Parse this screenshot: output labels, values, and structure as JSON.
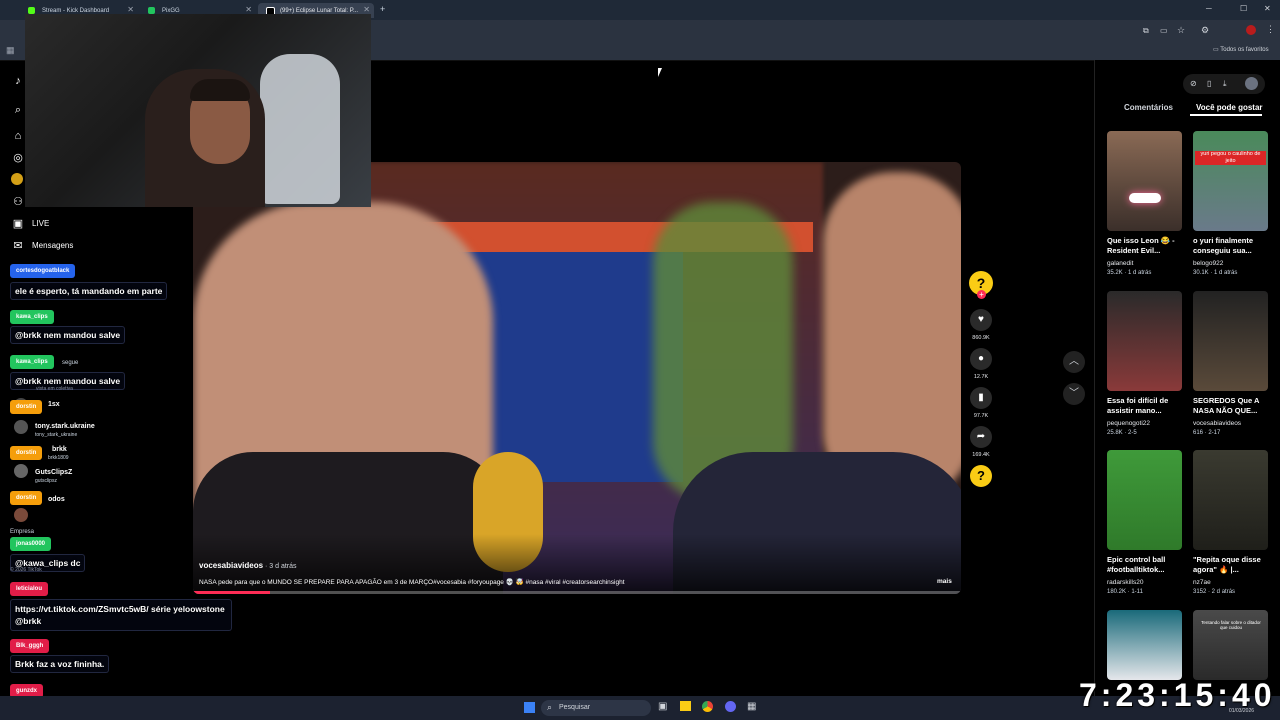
{
  "browser": {
    "tabs": [
      {
        "label": "Stream - Kick Dashboard"
      },
      {
        "label": "PixGG"
      },
      {
        "label": "(99+) Eclipse Lunar Total: P..."
      }
    ],
    "bookmarks_label": "Todos os favoritos"
  },
  "sidebar": {
    "live_label": "LIVE",
    "messages_label": "Mensagens",
    "faded_items": [
      "Seguir",
      "segue",
      "vista em coletiva",
      "1sx",
      "tony.stark.ukraine",
      "tony_stark_ukraine",
      "brkk",
      "brkk1809",
      "GutsClipsZ",
      "gutsclipsz",
      "odos",
      "Empresa",
      "© 2026 TikTok"
    ]
  },
  "chat": [
    {
      "user": "cortesdogoatblack",
      "color": "#2563eb",
      "message": "ele é esperto, tá mandando em parte"
    },
    {
      "user": "kawa_clips",
      "color": "#22c55e",
      "message": "@brkk nem mandou salve"
    },
    {
      "user": "kawa_clips",
      "color": "#22c55e",
      "message": "@brkk nem mandou salve"
    },
    {
      "user": "dorstin",
      "color": "#f59e0b",
      "message": ""
    },
    {
      "user": "dorstin",
      "color": "#f59e0b",
      "message": ""
    },
    {
      "user": "dorstin",
      "color": "#f59e0b",
      "message": ""
    },
    {
      "user": "jonas0000",
      "color": "#22c55e",
      "message": "@kawa_clips dc"
    },
    {
      "user": "leticialou",
      "color": "#e11d48",
      "message": "https://vt.tiktok.com/ZSmvtc5wB/ série yeloowstone @brkk"
    },
    {
      "user": "Blk_gggh",
      "color": "#e11d48",
      "message": "Brkk faz a voz fininha."
    },
    {
      "user": "gunzdx",
      "color": "#e11d48",
      "message": ""
    }
  ],
  "video": {
    "author": "vocesabiavideos",
    "time": " · 3 d atrás",
    "caption": "NASA pede para que o MUNDO SE PREPARE PARA APAGÃO em 3 de MARÇO#vocesabia #foryoupage 💀 🤯 #nasa #viral #creatorsearchinsight",
    "more": "mais",
    "progress": 0.1
  },
  "actions": {
    "likes": "860.9K",
    "comments": "12.7K",
    "saves": "97.7K",
    "shares": "169.4K"
  },
  "right_panel": {
    "tab_comments": "Comentários",
    "tab_suggested": "Você pode gostar",
    "items": [
      {
        "title": "Que isso Leon 😂 - Resident Evil...",
        "author": "galanedit",
        "meta": "35.2K · 1 d atrás",
        "overlay": ""
      },
      {
        "title": "o yuri finalmente conseguiu sua...",
        "author": "belogo922",
        "meta": "30.1K · 1 d atrás",
        "overlay": "yuri pegou o caulinho de jeito"
      },
      {
        "title": "Essa foi difícil de assistir mano...",
        "author": "pequenogoti22",
        "meta": "25.8K · 2-5",
        "overlay": ""
      },
      {
        "title": "SEGREDOS Que A NASA NÃO QUE...",
        "author": "vocesabiavideos",
        "meta": "616 · 2-17",
        "overlay": ""
      },
      {
        "title": "Epic control ball #footballtiktok...",
        "author": "radarskills20",
        "meta": "180.2K · 1-11",
        "overlay": ""
      },
      {
        "title": "\"Repita oque disse agora\" 🔥 |...",
        "author": "nz7ae",
        "meta": "3152 · 2 d atrás",
        "overlay": ""
      },
      {
        "title": "",
        "author": "",
        "meta": "",
        "overlay": ""
      },
      {
        "title": "",
        "author": "",
        "meta": "",
        "overlay": "Tentando falar sobre o ditador que cuidou"
      }
    ]
  },
  "taskbar": {
    "search_placeholder": "Pesquisar",
    "date": "01/03/2026"
  },
  "overlay_clock": "7:23:15:40"
}
